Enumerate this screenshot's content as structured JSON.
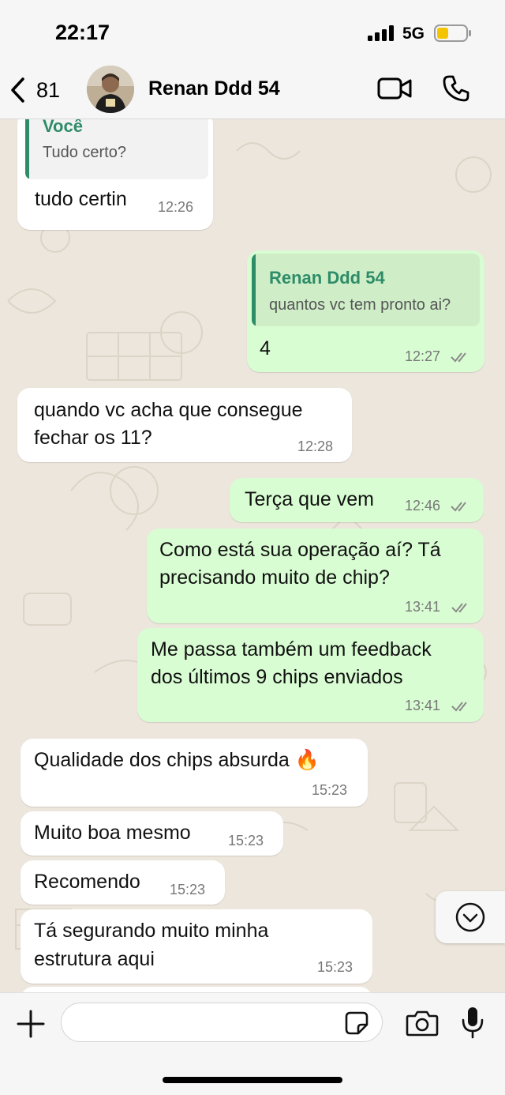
{
  "status_bar": {
    "time": "22:17",
    "network": "5G"
  },
  "header": {
    "back_count": "81",
    "contact_name": "Renan Ddd 54"
  },
  "messages": [
    {
      "direction": "in",
      "quote_name": "Você",
      "quote_text": "Tudo certo?",
      "lines": [
        "tudo certin"
      ],
      "time": "12:26"
    },
    {
      "direction": "out",
      "quote_name": "Renan Ddd 54",
      "quote_text": "quantos vc tem pronto ai?",
      "lines": [
        "4"
      ],
      "time": "12:27",
      "read": true
    },
    {
      "direction": "in",
      "lines": [
        "quando vc acha que consegue",
        "fechar os 11?"
      ],
      "time": "12:28"
    },
    {
      "direction": "out",
      "lines": [
        "Terça que vem"
      ],
      "time": "12:46",
      "read": true
    },
    {
      "direction": "out",
      "lines": [
        "Como está sua operação aí? Tá",
        "precisando muito de chip?"
      ],
      "time": "13:41",
      "read": true
    },
    {
      "direction": "out",
      "lines": [
        "Me passa também um feedback",
        "dos últimos 9 chips enviados"
      ],
      "time": "13:41",
      "read": true
    },
    {
      "direction": "in",
      "lines": [
        "Qualidade dos chips absurda 🔥"
      ],
      "time": "15:23"
    },
    {
      "direction": "in",
      "lines": [
        "Muito boa mesmo"
      ],
      "time": "15:23"
    },
    {
      "direction": "in",
      "lines": [
        "Recomendo"
      ],
      "time": "15:23"
    },
    {
      "direction": "in",
      "lines": [
        "Tá segurando muito minha",
        "estrutura aqui"
      ],
      "time": "15:23"
    }
  ],
  "composer": {
    "placeholder": ""
  },
  "colors": {
    "incoming_bubble": "#ffffff",
    "outgoing_bubble": "#d9fdd3",
    "quote_accent": "#2e8c68",
    "read_ticks": "#8a8a8a",
    "wallpaper": "#ece6dc"
  },
  "icons": [
    "signal-icon",
    "battery-icon",
    "back-chevron-icon",
    "video-call-icon",
    "phone-icon",
    "read-ticks-icon",
    "chevron-down-icon",
    "plus-icon",
    "sticker-icon",
    "camera-icon",
    "microphone-icon"
  ]
}
